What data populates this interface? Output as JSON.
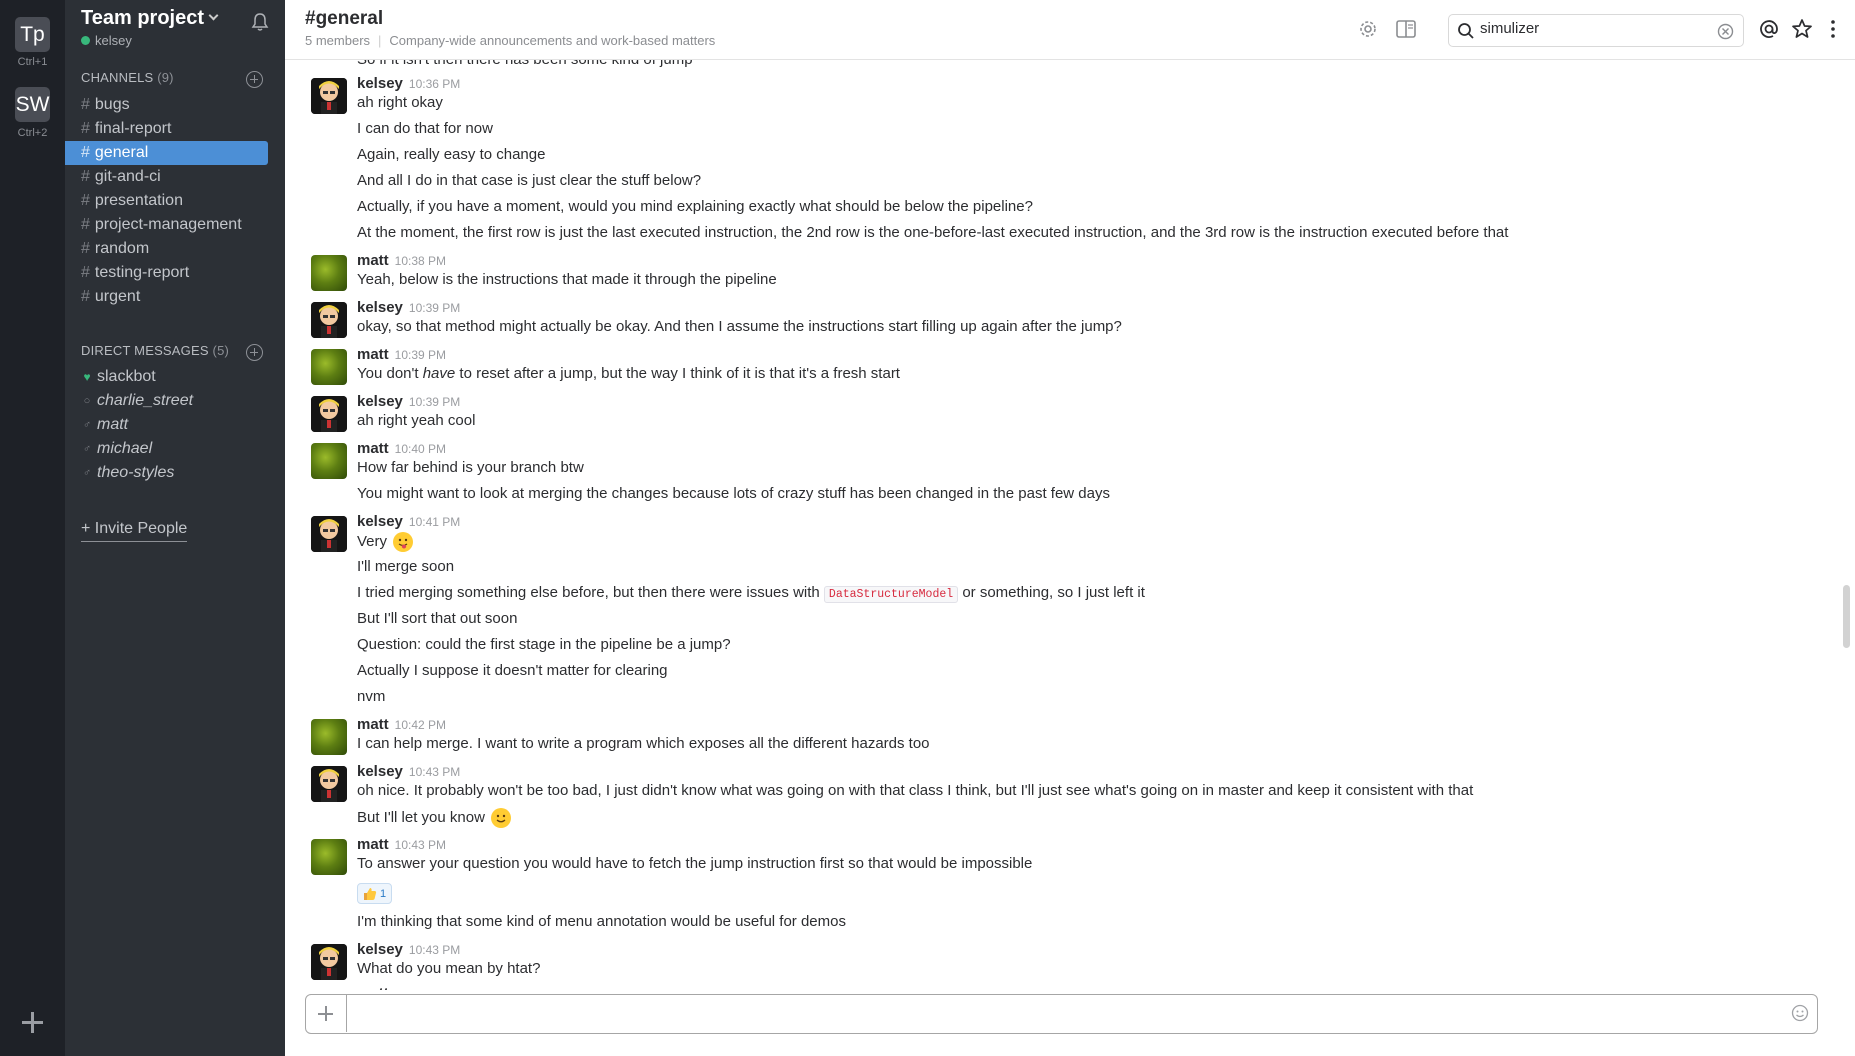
{
  "team_rail": {
    "teams": [
      {
        "initials": "Tp",
        "shortcut": "Ctrl+1"
      },
      {
        "initials": "SW",
        "shortcut": "Ctrl+2"
      }
    ]
  },
  "sidebar": {
    "team_name": "Team project",
    "username": "kelsey",
    "channels_label": "CHANNELS",
    "channels_count": "(9)",
    "channels": [
      "bugs",
      "final-report",
      "general",
      "git-and-ci",
      "presentation",
      "project-management",
      "random",
      "testing-report",
      "urgent"
    ],
    "active_channel": "general",
    "dm_label": "DIRECT MESSAGES",
    "dm_count": "(5)",
    "direct_messages": [
      {
        "name": "slackbot",
        "presence": "heart"
      },
      {
        "name": "charlie_street",
        "presence": "away"
      },
      {
        "name": "matt",
        "presence": "away"
      },
      {
        "name": "michael",
        "presence": "away"
      },
      {
        "name": "theo-styles",
        "presence": "away"
      }
    ],
    "invite_label": "+ Invite People"
  },
  "header": {
    "channel": "#general",
    "members": "5 members",
    "purpose": "Company-wide announcements and work-based matters",
    "search_value": "simulizer"
  },
  "messages": {
    "cut_top": "So if it isn't then there has been some kind of jump",
    "m1_author": "kelsey",
    "m1_time": "10:36 PM",
    "m1_l1": "ah right okay",
    "m1_l2": "I can do that for now",
    "m1_l3": "Again, really easy to change",
    "m1_l4": "And all I do in that case is just clear the stuff below?",
    "m1_l5": "Actually, if you have a moment, would you mind explaining exactly what should be below the pipeline?",
    "m1_l6": "At the moment, the first row is just the last executed instruction, the 2nd row is the one-before-last executed instruction, and the 3rd row is the instruction executed before that",
    "m2_author": "matt",
    "m2_time": "10:38 PM",
    "m2_l1": "Yeah, below is the instructions that made it through the pipeline",
    "m3_author": "kelsey",
    "m3_time": "10:39 PM",
    "m3_l1": "okay, so that method might actually be okay. And then I assume the instructions start filling up again after the jump?",
    "m4_author": "matt",
    "m4_time": "10:39 PM",
    "m4_l1_a": "You don't ",
    "m4_l1_em": "have",
    "m4_l1_b": " to reset after a jump, but the way I think of it is that it's a fresh start",
    "m5_author": "kelsey",
    "m5_time": "10:39 PM",
    "m5_l1": "ah right yeah cool",
    "m6_author": "matt",
    "m6_time": "10:40 PM",
    "m6_l1": "How far behind is your branch btw",
    "m6_l2": "You might want to look at merging the changes because lots of crazy stuff has been changed in the past few days",
    "m7_author": "kelsey",
    "m7_time": "10:41 PM",
    "m7_l1": "Very",
    "m7_l2": "I'll merge soon",
    "m7_l3_a": "I tried merging something else before, but then there were issues with ",
    "m7_l3_code": "DataStructureModel",
    "m7_l3_b": " or something, so I just left it",
    "m7_l4": "But I'll sort that out soon",
    "m7_l5": "Question: could the first stage in the pipeline be a jump?",
    "m7_l6": "Actually I suppose it doesn't matter for clearing",
    "m7_l7": "nvm",
    "m8_author": "matt",
    "m8_time": "10:42 PM",
    "m8_l1": "I can help merge. I want to write a program which exposes all the different hazards too",
    "m9_author": "kelsey",
    "m9_time": "10:43 PM",
    "m9_l1": "oh nice. It probably won't be too bad, I just didn't know what was going on with that class I think, but I'll just see what's going on in master and keep it consistent with that",
    "m9_l2": "But I'll let you know",
    "m10_author": "matt",
    "m10_time": "10:43 PM",
    "m10_l1": "To answer your question you would have to fetch the jump instruction first so that would be impossible",
    "m10_reaction_count": "1",
    "m10_l2": "I'm thinking that some kind of menu annotation would be useful for demos",
    "m11_author": "kelsey",
    "m11_time": "10:43 PM",
    "m11_l1": "What do you mean by htat?",
    "cut_bottom": "matt"
  },
  "colors": {
    "rail_bg": "#1e2127",
    "sidebar_bg": "#2c3036",
    "active_channel_bg": "#4c8fd6",
    "online": "#38b87c",
    "code_text": "#d72b3f"
  }
}
